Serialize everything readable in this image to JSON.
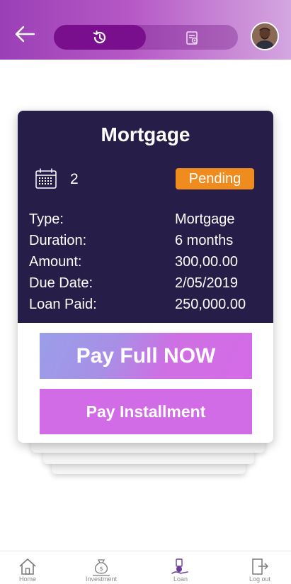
{
  "header": {
    "back_icon": "arrow-left-icon",
    "segments": [
      {
        "icon": "history-icon",
        "active": true
      },
      {
        "icon": "loan-document-icon",
        "active": false
      }
    ],
    "avatar_icon": "user-avatar"
  },
  "card": {
    "title": "Mortgage",
    "calendar_icon": "calendar-icon",
    "count": "2",
    "status": "Pending",
    "rows": [
      {
        "label": "Type:",
        "value": "Mortgage"
      },
      {
        "label": "Duration:",
        "value": "6 months"
      },
      {
        "label": "Amount:",
        "value": "300,00.00"
      },
      {
        "label": "Due Date:",
        "value": "2/05/2019"
      },
      {
        "label": "Loan Paid:",
        "value": "250,000.00"
      }
    ],
    "pay_full_label": "Pay Full NOW",
    "pay_installment_label": "Pay Installment"
  },
  "tabbar": {
    "items": [
      {
        "label": "Home",
        "icon": "home-icon"
      },
      {
        "label": "Investment",
        "icon": "money-bag-icon"
      },
      {
        "label": "Loan",
        "icon": "loan-hand-icon",
        "active": true
      },
      {
        "label": "Log out",
        "icon": "logout-icon"
      }
    ]
  },
  "colors": {
    "header_gradient": [
      "#9a3fb6",
      "#d4a6e0"
    ],
    "card_dark": "#261e48",
    "badge": "#f08b1e",
    "button_purple": "#d16be6",
    "segment_active": "#7a0f8e"
  }
}
